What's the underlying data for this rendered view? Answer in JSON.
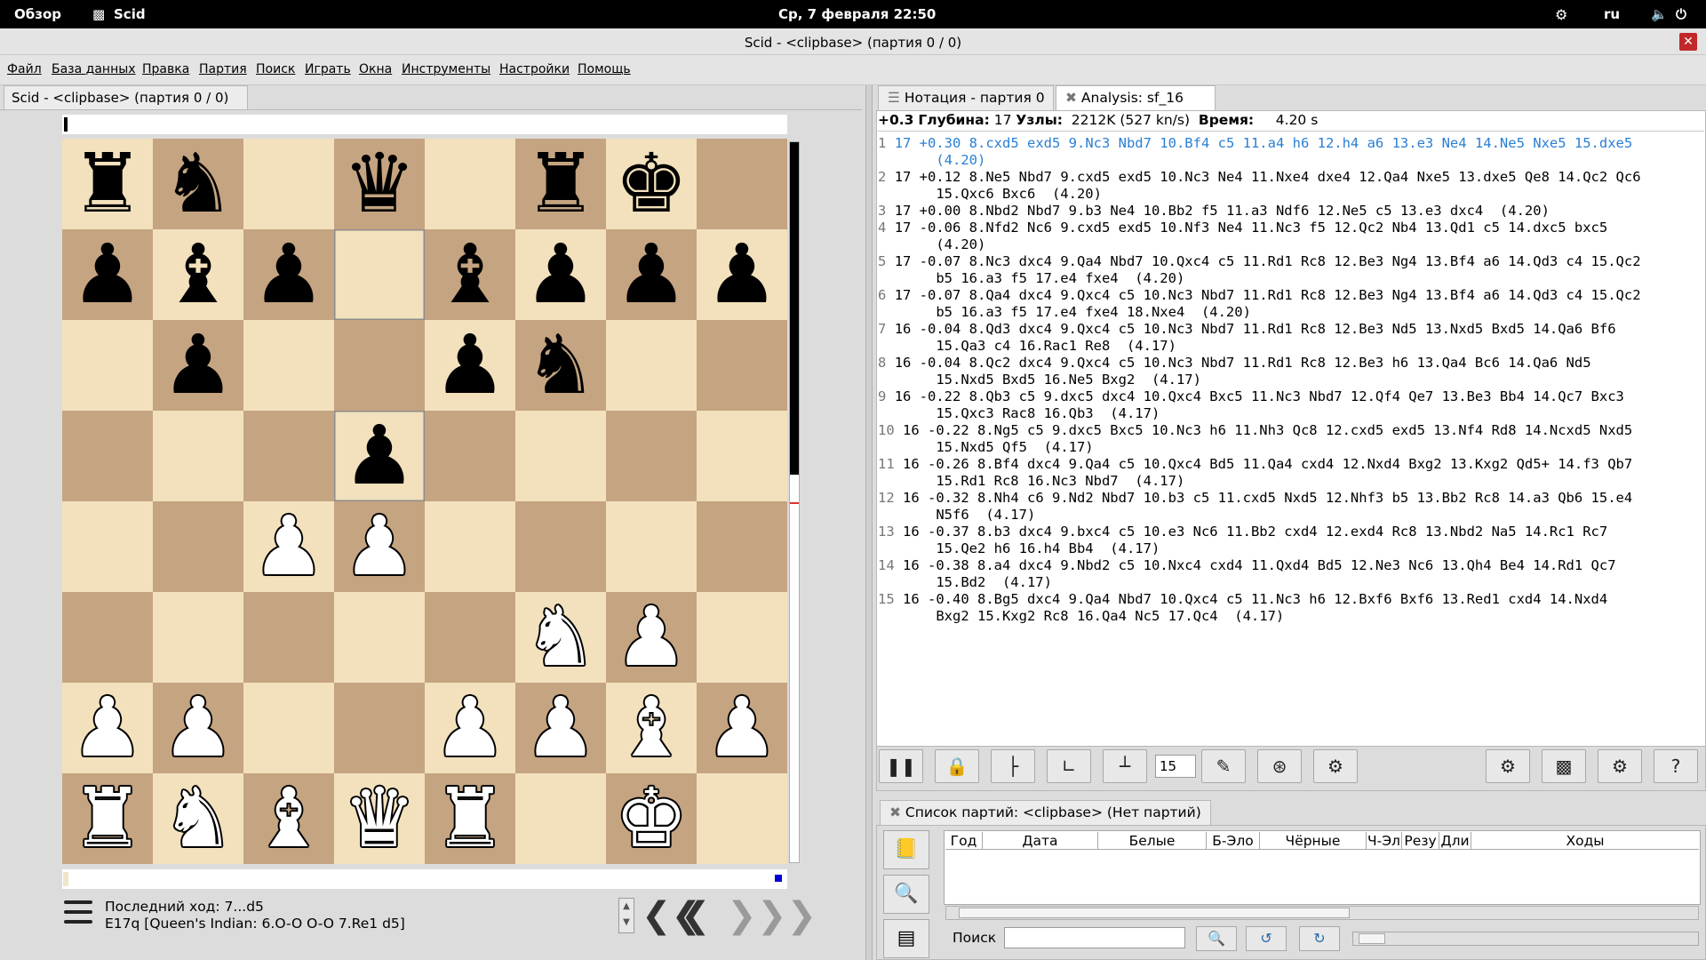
{
  "topbar": {
    "overview": "Обзор",
    "app_name": "Scid",
    "clock": "Ср, 7 февраля 22:50",
    "lang": "ru",
    "gear_icon": "gear-icon",
    "volume_icon": "volume-icon",
    "power_icon": "power-icon"
  },
  "window": {
    "title": "Scid - <clipbase> (партия 0 / 0)",
    "close": "✕"
  },
  "menu": [
    "Файл",
    "База данных",
    "Правка",
    "Партия",
    "Поиск",
    "Играть",
    "Окна",
    "Инструменты",
    "Настройки",
    "Помощь"
  ],
  "left": {
    "tab": "Scid - <clipbase> (партия 0 / 0)",
    "last_move": "Последний ход: 7...d5",
    "opening": "E17q [Queen's Indian: 6.O-O O-O 7.Re1 d5]",
    "eval_white_fraction": 0.54
  },
  "board": {
    "rows": [
      [
        "r",
        "n",
        "",
        "q",
        "",
        "r",
        "k",
        ""
      ],
      [
        "p",
        "b",
        "p",
        "",
        "b",
        "p",
        "p",
        "p"
      ],
      [
        "",
        "p",
        "",
        "",
        "p",
        "n",
        "",
        ""
      ],
      [
        "",
        "",
        "",
        "p",
        "",
        "",
        "",
        ""
      ],
      [
        "",
        "",
        "P",
        "P",
        "",
        "",
        "",
        ""
      ],
      [
        "",
        "",
        "",
        "",
        "",
        "N",
        "P",
        ""
      ],
      [
        "P",
        "P",
        "",
        "",
        "P",
        "P",
        "B",
        "P"
      ],
      [
        "R",
        "N",
        "B",
        "Q",
        "R",
        "",
        "K",
        ""
      ]
    ],
    "highlight": [
      [
        1,
        3
      ],
      [
        3,
        3
      ]
    ]
  },
  "right": {
    "tab_notation": "Нотация - партия 0",
    "tab_analysis": "Analysis: sf_16",
    "score": "+0.3",
    "depth_label": "Глубина:",
    "depth": "17",
    "nodes_label": "Узлы:",
    "nodes": "2212K (527 kn/s)",
    "time_label": "Время:",
    "time": "4.20 s",
    "lines": [
      {
        "n": "1",
        "t": "17 +0.30 8.cxd5 exd5 9.Nc3 Nbd7 10.Bf4 c5 11.a4 h6 12.h4 a6 13.e3 Ne4 14.Ne5 Nxe5 15.dxe5",
        "t2": "       (4.20)"
      },
      {
        "n": "2",
        "t": "17 +0.12 8.Ne5 Nbd7 9.cxd5 exd5 10.Nc3 Ne4 11.Nxe4 dxe4 12.Qa4 Nxe5 13.dxe5 Qe8 14.Qc2 Qc6",
        "t2": "       15.Qxc6 Bxc6  (4.20)"
      },
      {
        "n": "3",
        "t": "17 +0.00 8.Nbd2 Nbd7 9.b3 Ne4 10.Bb2 f5 11.a3 Ndf6 12.Ne5 c5 13.e3 dxc4  (4.20)",
        "t2": ""
      },
      {
        "n": "4",
        "t": "17 -0.06 8.Nfd2 Nc6 9.cxd5 exd5 10.Nf3 Ne4 11.Nc3 f5 12.Qc2 Nb4 13.Qd1 c5 14.dxc5 bxc5",
        "t2": "       (4.20)"
      },
      {
        "n": "5",
        "t": "17 -0.07 8.Nc3 dxc4 9.Qa4 Nbd7 10.Qxc4 c5 11.Rd1 Rc8 12.Be3 Ng4 13.Bf4 a6 14.Qd3 c4 15.Qc2",
        "t2": "       b5 16.a3 f5 17.e4 fxe4  (4.20)"
      },
      {
        "n": "6",
        "t": "17 -0.07 8.Qa4 dxc4 9.Qxc4 c5 10.Nc3 Nbd7 11.Rd1 Rc8 12.Be3 Ng4 13.Bf4 a6 14.Qd3 c4 15.Qc2",
        "t2": "       b5 16.a3 f5 17.e4 fxe4 18.Nxe4  (4.20)"
      },
      {
        "n": "7",
        "t": "16 -0.04 8.Qd3 dxc4 9.Qxc4 c5 10.Nc3 Nbd7 11.Rd1 Rc8 12.Be3 Nd5 13.Nxd5 Bxd5 14.Qa6 Bf6",
        "t2": "       15.Qa3 c4 16.Rac1 Re8  (4.17)"
      },
      {
        "n": "8",
        "t": "16 -0.04 8.Qc2 dxc4 9.Qxc4 c5 10.Nc3 Nbd7 11.Rd1 Rc8 12.Be3 h6 13.Qa4 Bc6 14.Qa6 Nd5",
        "t2": "       15.Nxd5 Bxd5 16.Ne5 Bxg2  (4.17)"
      },
      {
        "n": "9",
        "t": "16 -0.22 8.Qb3 c5 9.dxc5 dxc4 10.Qxc4 Bxc5 11.Nc3 Nbd7 12.Qf4 Qe7 13.Be3 Bb4 14.Qc7 Bxc3",
        "t2": "       15.Qxc3 Rac8 16.Qb3  (4.17)"
      },
      {
        "n": "10",
        "t": "16 -0.22 8.Ng5 c5 9.dxc5 Bxc5 10.Nc3 h6 11.Nh3 Qc8 12.cxd5 exd5 13.Nf4 Rd8 14.Ncxd5 Nxd5",
        "t2": "       15.Nxd5 Qf5  (4.17)"
      },
      {
        "n": "11",
        "t": "16 -0.26 8.Bf4 dxc4 9.Qa4 c5 10.Qxc4 Bd5 11.Qa4 cxd4 12.Nxd4 Bxg2 13.Kxg2 Qd5+ 14.f3 Qb7",
        "t2": "       15.Rd1 Rc8 16.Nc3 Nbd7  (4.17)"
      },
      {
        "n": "12",
        "t": "16 -0.32 8.Nh4 c6 9.Nd2 Nbd7 10.b3 c5 11.cxd5 Nxd5 12.Nhf3 b5 13.Bb2 Rc8 14.a3 Qb6 15.e4",
        "t2": "       N5f6  (4.17)"
      },
      {
        "n": "13",
        "t": "16 -0.37 8.b3 dxc4 9.bxc4 c5 10.e3 Nc6 11.Bb2 cxd4 12.exd4 Rc8 13.Nbd2 Na5 14.Rc1 Rc7",
        "t2": "       15.Qe2 h6 16.h4 Bb4  (4.17)"
      },
      {
        "n": "14",
        "t": "16 -0.38 8.a4 dxc4 9.Nbd2 c5 10.Nxc4 cxd4 11.Qxd4 Bd5 12.Ne3 Nc6 13.Qh4 Be4 14.Rd1 Qc7",
        "t2": "       15.Bd2  (4.17)"
      },
      {
        "n": "15",
        "t": "16 -0.40 8.Bg5 dxc4 9.Qa4 Nbd7 10.Qxc4 c5 11.Nc3 h6 12.Bxf6 Bxf6 13.Red1 cxd4 14.Nxd4",
        "t2": "       Bxg2 15.Kxg2 Rc8 16.Qa4 Nc5 17.Qc4  (4.17)"
      }
    ],
    "depth_spin": "15",
    "games_tab": "Список партий: <clipbase> (Нет партий)",
    "cols": [
      "Год",
      "Дата",
      "Белые",
      "Б-Эло",
      "Чёрные",
      "Ч-Эл",
      "Резу",
      "Дли",
      "Ходы"
    ],
    "search_label": "Поиск",
    "search_value": ""
  },
  "colors": {
    "light": "#f3e1bd",
    "dark": "#c5a481",
    "selected_line": "#2a7fd4"
  }
}
